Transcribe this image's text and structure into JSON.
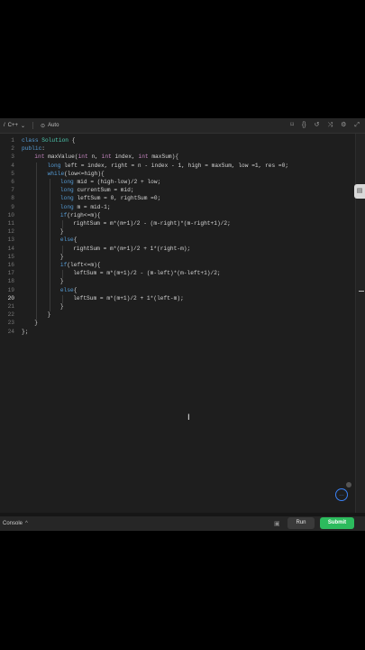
{
  "toolbar": {
    "language": "C++",
    "mode": "Auto",
    "icons": [
      "bookmark-icon",
      "braces-icon",
      "reset-icon",
      "shuffle-icon",
      "settings-icon",
      "fullscreen-icon"
    ]
  },
  "editor": {
    "active_line": 20,
    "lines": [
      {
        "n": "1",
        "indent": 0,
        "text": "class Solution {"
      },
      {
        "n": "2",
        "indent": 0,
        "text": "public:"
      },
      {
        "n": "3",
        "indent": 1,
        "text": "int maxValue(int n, int index, int maxSum){"
      },
      {
        "n": "4",
        "indent": 2,
        "text": "long left = index, right = n - index - 1, high = maxSum, low =1, res =0;"
      },
      {
        "n": "5",
        "indent": 2,
        "text": "while(low<=high){"
      },
      {
        "n": "6",
        "indent": 3,
        "text": "long mid = (high-low)/2 + low;"
      },
      {
        "n": "7",
        "indent": 3,
        "text": "long currentSum = mid;"
      },
      {
        "n": "8",
        "indent": 3,
        "text": "long leftSum = 0, rightSum =0;"
      },
      {
        "n": "9",
        "indent": 3,
        "text": "long m = mid-1;"
      },
      {
        "n": "10",
        "indent": 3,
        "text": "if(righ<=m){"
      },
      {
        "n": "11",
        "indent": 4,
        "text": "rightSum = m*(m+1)/2 - (m-right)*(m-right+1)/2;"
      },
      {
        "n": "12",
        "indent": 3,
        "text": "}"
      },
      {
        "n": "13",
        "indent": 3,
        "text": "else{"
      },
      {
        "n": "14",
        "indent": 4,
        "text": "rightSum = m*(m+1)/2 + 1*(right-m);"
      },
      {
        "n": "15",
        "indent": 3,
        "text": "}"
      },
      {
        "n": "16",
        "indent": 3,
        "text": "if(left<=m){"
      },
      {
        "n": "17",
        "indent": 4,
        "text": "leftSum = m*(m+1)/2 - (m-left)*(m-left+1)/2;"
      },
      {
        "n": "18",
        "indent": 3,
        "text": "}"
      },
      {
        "n": "19",
        "indent": 3,
        "text": "else{"
      },
      {
        "n": "20",
        "indent": 4,
        "text": "leftSum = m*(m+1)/2 + 1*(left-m);"
      },
      {
        "n": "21",
        "indent": 3,
        "text": "}"
      },
      {
        "n": "22",
        "indent": 2,
        "text": "}"
      },
      {
        "n": "23",
        "indent": 1,
        "text": "}"
      },
      {
        "n": "24",
        "indent": 0,
        "text": "};"
      }
    ]
  },
  "console": {
    "label": "Console",
    "run_label": "Run",
    "submit_label": "Submit"
  },
  "colors": {
    "keyword": "#569cd6",
    "type": "#c586c0",
    "submit": "#2cbb5d"
  }
}
